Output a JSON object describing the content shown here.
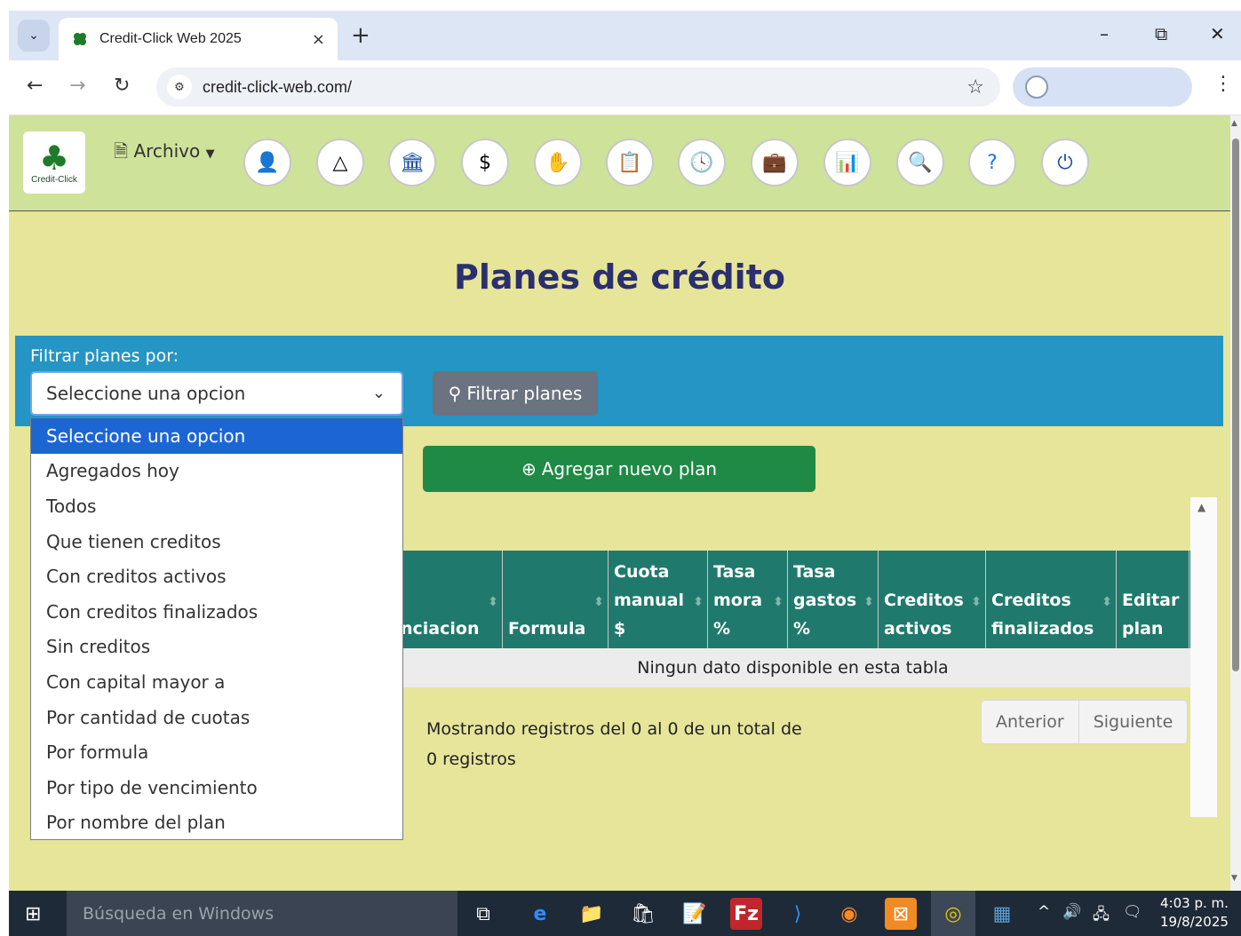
{
  "browser": {
    "tab_title": "Credit-Click Web 2025",
    "tab_close": "×",
    "new_tab": "+",
    "url": "credit-click-web.com/",
    "minimize": "–",
    "restore": "⧉",
    "close": "✕"
  },
  "header": {
    "logo_text": "Credit-Click",
    "menu_archivo": "Archivo",
    "toolbar_icons": [
      "user-icon",
      "shapes-icon",
      "bank-icon",
      "money-chart-icon",
      "cash-hand-icon",
      "document-icon",
      "clock-icon",
      "briefcase-icon",
      "bar-chart-icon",
      "search-icon",
      "help-icon",
      "power-icon"
    ]
  },
  "page": {
    "title": "Planes de crédito",
    "filter_label": "Filtrar planes por:",
    "select_value": "Seleccione una opcion",
    "filter_button": "Filtrar planes",
    "add_button": "Agregar nuevo plan",
    "dropdown_options": [
      "Seleccione una opcion",
      "Agregados hoy",
      "Todos",
      "Que tienen creditos",
      "Con creditos activos",
      "Con creditos finalizados",
      "Sin creditos",
      "Con capital mayor a",
      "Por cantidad de cuotas",
      "Por formula",
      "Por tipo de vencimiento",
      "Por nombre del plan"
    ],
    "table": {
      "columns": [
        {
          "line1": "",
          "line2": "nciacion",
          "line3": ""
        },
        {
          "line1": "",
          "line2": "",
          "line3": "Formula"
        },
        {
          "line1": "Cuota",
          "line2": "manual",
          "line3": "$"
        },
        {
          "line1": "Tasa",
          "line2": "mora",
          "line3": "%"
        },
        {
          "line1": "Tasa",
          "line2": "gastos",
          "line3": "%"
        },
        {
          "line1": "",
          "line2": "Creditos",
          "line3": "activos"
        },
        {
          "line1": "",
          "line2": "Creditos",
          "line3": "finalizados"
        },
        {
          "line1": "",
          "line2": "Editar",
          "line3": "plan"
        }
      ],
      "empty_message": "Ningun dato disponible en esta tabla"
    },
    "info_text": "Mostrando registros del 0 al 0 de un total de 0 registros",
    "pager": {
      "prev": "Anterior",
      "next": "Siguiente"
    }
  },
  "taskbar": {
    "search_placeholder": "Búsqueda en Windows",
    "time": "4:03 p. m.",
    "date": "19/8/2025"
  },
  "colors": {
    "header_bg": "#cfe29a",
    "page_bg": "#e6e59a",
    "filter_bar": "#2495c4",
    "table_header": "#1f7a6d",
    "add_button": "#1f8a45",
    "title": "#2b2f6e",
    "selected_option": "#1c66d4"
  }
}
